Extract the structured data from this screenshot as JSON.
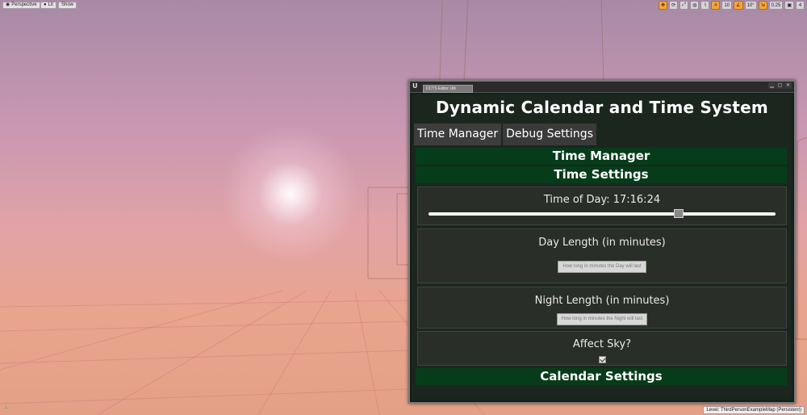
{
  "viewport": {
    "toolbar_left": [
      "Perspective",
      "Lit",
      "Show"
    ],
    "toolbar_right": [
      "10",
      "10°",
      "0.25",
      "4"
    ],
    "level_label": "Level:  ThirdPersonExampleMap (Persistent)"
  },
  "window": {
    "tab_label": "DCTS Editor Util",
    "title": "Dynamic Calendar and Time System",
    "tabs": [
      "Time Manager",
      "Debug Settings"
    ],
    "time_manager_header": "Time Manager",
    "time_settings_header": "Time Settings",
    "time_of_day_label": "Time of Day:  17:16:24",
    "time_of_day_fraction": 0.72,
    "day_length_label": "Day Length (in minutes)",
    "day_length_placeholder": "How long in minutes the Day will last",
    "night_length_label": "Night Length (in minutes)",
    "night_length_placeholder": "How long in minutes the Night will last",
    "affect_sky_label": "Affect Sky?",
    "affect_sky_checked": true,
    "calendar_settings_header": "Calendar Settings"
  }
}
